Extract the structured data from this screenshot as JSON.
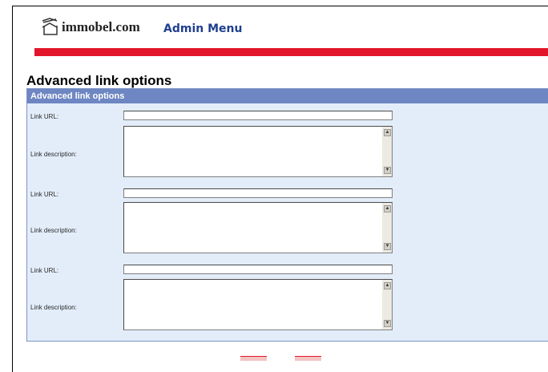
{
  "header": {
    "logo_text": "immobel.com",
    "admin_menu": "Admin Menu",
    "accent_color": "#e2162a",
    "panel_header_color": "#6e86c2"
  },
  "page": {
    "title": "Advanced link options"
  },
  "panel": {
    "header": "Advanced link options",
    "links": [
      {
        "url_label": "Link URL:",
        "url_value": "",
        "desc_label": "Link description:",
        "desc_value": ""
      },
      {
        "url_label": "Link URL:",
        "url_value": "",
        "desc_label": "Link description:",
        "desc_value": ""
      },
      {
        "url_label": "Link URL:",
        "url_value": "",
        "desc_label": "Link description:",
        "desc_value": ""
      }
    ]
  },
  "icons": {
    "logo": "house-outline-icon",
    "scroll_up": "scroll-up-arrow-icon",
    "scroll_down": "scroll-down-arrow-icon"
  }
}
